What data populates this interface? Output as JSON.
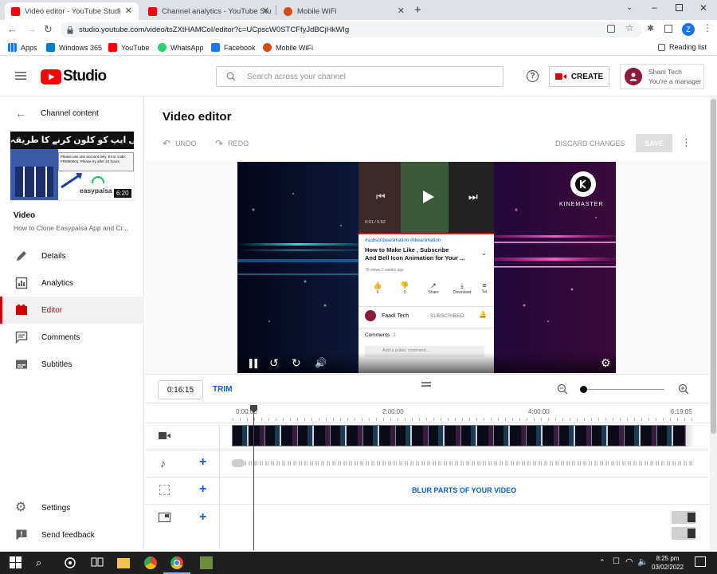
{
  "browser": {
    "tabs": [
      {
        "title": "Video editor - YouTube Studi",
        "active": true
      },
      {
        "title": "Channel analytics - YouTube Stu",
        "active": false
      },
      {
        "title": "Mobile WiFi",
        "active": false
      }
    ],
    "url": "studio.youtube.com/video/tsZXtHAMCoI/editor?c=UCpscW0STCFfyJdBCjHkWIg",
    "bookmarks": [
      "Apps",
      "Windows 365",
      "YouTube",
      "WhatsApp",
      "Facebook",
      "Mobile WiFi"
    ],
    "reading_list": "Reading list",
    "profile_initial": "Z"
  },
  "header": {
    "logo_text": "Studio",
    "search_placeholder": "Search across your channel",
    "create_label": "CREATE",
    "account_name": "Shani Tech",
    "account_role": "You're a manager"
  },
  "sidebar": {
    "back_label": "Channel content",
    "thumbnail_banner": "بڑی ہی ایپ کو کلون کرنے کا طریقہ",
    "thumbnail_brand": "easypaisa",
    "thumbnail_badge": "6:20",
    "thumbnail_popup": "Please use one account only. Error code: FRM00001. Please try after 24 hours",
    "video_label": "Video",
    "video_title": "How to Clone Easypaisa App and Cr...",
    "items": [
      {
        "label": "Details",
        "icon": "pencil-icon",
        "selected": false
      },
      {
        "label": "Analytics",
        "icon": "analytics-icon",
        "selected": false
      },
      {
        "label": "Editor",
        "icon": "editor-icon",
        "selected": true
      },
      {
        "label": "Comments",
        "icon": "comments-icon",
        "selected": false
      },
      {
        "label": "Subtitles",
        "icon": "subtitles-icon",
        "selected": false
      }
    ],
    "settings_label": "Settings",
    "feedback_label": "Send feedback"
  },
  "editor": {
    "title": "Video editor",
    "undo_label": "UNDO",
    "redo_label": "REDO",
    "discard_label": "DISCARD CHANGES",
    "save_label": "SAVE",
    "current_time": "0:16:15",
    "trim_label": "TRIM",
    "ruler": [
      "0:00:00",
      "2:00:00",
      "4:00:00",
      "6:19:05"
    ],
    "blur_label": "BLUR PARTS OF YOUR VIDEO"
  },
  "video_overlay": {
    "brand": "KINEMASTER",
    "yt_time": "0:01 / 5:52",
    "hashtags": "#subscribeanimation #likeanimation",
    "title_line1": "How to Make Like , Subscribe",
    "title_line2": "And Bell Icon Animation for Your ...",
    "meta": "79 views  2 weeks ago",
    "actions": [
      "6",
      "0",
      "Share",
      "Download",
      "Sa"
    ],
    "channel": "Faadi Tech",
    "subscribed": "SUBSCRIBED",
    "comments_label": "Comments",
    "comments_count": "2",
    "comment_placeholder": "Add a public comment..."
  },
  "taskbar": {
    "time": "8:25 pm",
    "date": "03/02/2022"
  },
  "colors": {
    "accent_red": "#cc0000",
    "link_blue": "#065fd4",
    "player_bg": "#0a0820"
  }
}
